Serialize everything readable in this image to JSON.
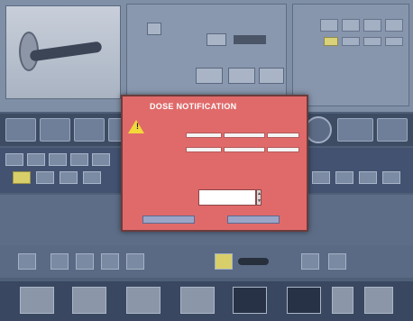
{
  "dialog": {
    "title": "DOSE NOTIFICATION",
    "icon": "warning-icon",
    "message": "",
    "table": {
      "row_labels": [
        "",
        ""
      ],
      "col_headers": [
        "",
        "",
        ""
      ],
      "cells": [
        [
          "",
          "",
          ""
        ],
        [
          "",
          "",
          ""
        ]
      ]
    },
    "input_label": "",
    "input_value": "",
    "buttons": [
      "",
      ""
    ]
  },
  "colors": {
    "dialog_bg": "#e06a6a",
    "warning": "#f2d83a",
    "ui_bg": "#4f5f78"
  }
}
